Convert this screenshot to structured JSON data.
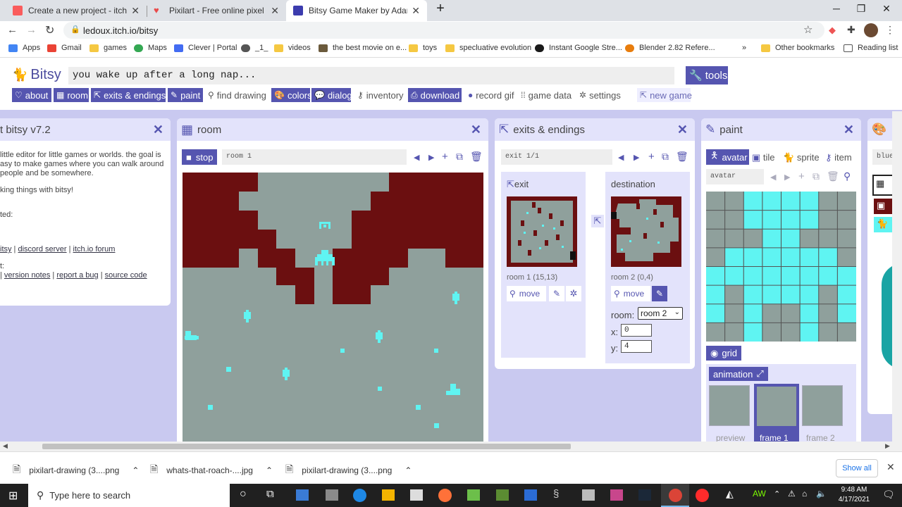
{
  "browser": {
    "tabs": [
      {
        "title": "Create a new project - itch.io",
        "color": "#fa5c5c"
      },
      {
        "title": "Pixilart - Free online pixel art dra",
        "color": "#e94a4a"
      },
      {
        "title": "Bitsy Game Maker by Adam Le D",
        "color": "#3c3cae"
      }
    ],
    "new_tab": "+",
    "url": "ledoux.itch.io/bitsy",
    "bookmarks": [
      "Apps",
      "Gmail",
      "games",
      "Maps",
      "Clever | Portal",
      "_1_",
      "videos",
      "the best movie on e...",
      "toys",
      "specluative evolution",
      "Instant Google Stre...",
      "Blender 2.82 Refere..."
    ],
    "bookmarks_more": "»",
    "other_bookmarks": "Other bookmarks",
    "reading_list": "Reading list"
  },
  "bitsy": {
    "logo": "Bitsy",
    "game_title": "you wake up after a long nap...",
    "tools_label": "tools",
    "nav": [
      {
        "label": "about",
        "on": true
      },
      {
        "label": "room",
        "on": true
      },
      {
        "label": "exits & endings",
        "on": true
      },
      {
        "label": "paint",
        "on": true
      },
      {
        "label": "find drawing",
        "on": false
      },
      {
        "label": "colors",
        "on": true
      },
      {
        "label": "dialog",
        "on": true
      },
      {
        "label": "inventory",
        "on": false
      },
      {
        "label": "download",
        "on": true
      },
      {
        "label": "record gif",
        "on": false
      },
      {
        "label": "game data",
        "on": false
      },
      {
        "label": "settings",
        "on": false
      },
      {
        "label": "new game",
        "on": false
      }
    ],
    "about": {
      "title": "t bitsy v7.2",
      "p1": "little editor for little games or worlds. the goal is",
      "p2": "asy to make games where you can walk around",
      "p3": "people and be somewhere.",
      "p4": "king things with bitsy!",
      "p5": "ted:",
      "links1": [
        "itsy",
        "discord server",
        "itch.io forum"
      ],
      "p6": "t:",
      "links2": [
        "version notes",
        "report a bug",
        "source code"
      ]
    },
    "room": {
      "title": "room",
      "stop_label": "stop",
      "room_name": "room 1"
    },
    "exits": {
      "title": "exits & endings",
      "exit_name": "exit 1/1",
      "exit_label": "exit",
      "destination_label": "destination",
      "exit_pos": "room 1 (15,13)",
      "dest_pos": "room 2 (0,4)",
      "move_label": "move",
      "room_field_label": "room:",
      "room_select": "room 2",
      "x_label": "x:",
      "x_value": "0",
      "y_label": "y:",
      "y_value": "4"
    },
    "paint": {
      "title": "paint",
      "tabs": [
        "avatar",
        "tile",
        "sprite",
        "item"
      ],
      "drawing_name": "avatar",
      "grid_label": "grid",
      "animation_label": "animation",
      "frames": [
        "preview",
        "frame 1",
        "frame 2"
      ]
    },
    "colors": {
      "field": "blue"
    },
    "palette": {
      "background": "#6b0f10",
      "tile": "#8fa09c",
      "sprite": "#5ff4f2",
      "ui": "#5555b0"
    }
  },
  "downloads": {
    "items": [
      "pixilart-drawing (3....png",
      "whats-that-roach-....jpg",
      "pixilart-drawing (3....png"
    ],
    "show_all": "Show all"
  },
  "taskbar": {
    "search": "Type here to search",
    "time": "9:48 AM",
    "date": "4/17/2021"
  }
}
